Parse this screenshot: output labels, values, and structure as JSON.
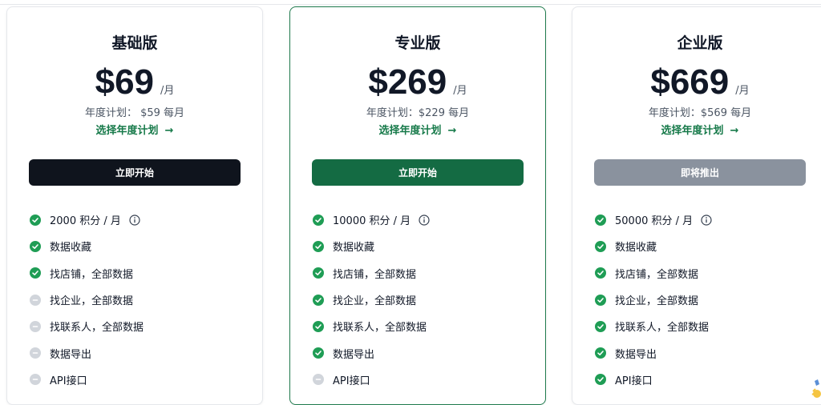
{
  "plans": [
    {
      "title": "基础版",
      "price": "$69",
      "period": "/月",
      "annual_text": "年度计划：  $59 每月",
      "annual_link": "选择年度计划",
      "cta": "立即开始",
      "cta_style": "dark",
      "features": [
        {
          "label": "2000 积分 / 月",
          "included": true,
          "info": true
        },
        {
          "label": "数据收藏",
          "included": true
        },
        {
          "label": "找店铺，全部数据",
          "included": true
        },
        {
          "label": "找企业，全部数据",
          "included": false
        },
        {
          "label": "找联系人，全部数据",
          "included": false
        },
        {
          "label": "数据导出",
          "included": false
        },
        {
          "label": "API接口",
          "included": false
        }
      ]
    },
    {
      "title": "专业版",
      "price": "$269",
      "period": "/月",
      "annual_text": "年度计划：$229 每月",
      "annual_link": "选择年度计划",
      "cta": "立即开始",
      "cta_style": "green",
      "featured": true,
      "features": [
        {
          "label": "10000 积分 / 月",
          "included": true,
          "info": true
        },
        {
          "label": "数据收藏",
          "included": true
        },
        {
          "label": "找店铺，全部数据",
          "included": true
        },
        {
          "label": "找企业，全部数据",
          "included": true
        },
        {
          "label": "找联系人，全部数据",
          "included": true
        },
        {
          "label": "数据导出",
          "included": true
        },
        {
          "label": "API接口",
          "included": false
        }
      ]
    },
    {
      "title": "企业版",
      "price": "$669",
      "period": "/月",
      "annual_text": "年度计划：$569 每月",
      "annual_link": "选择年度计划",
      "cta": "即将推出",
      "cta_style": "gray",
      "features": [
        {
          "label": "50000 积分 / 月",
          "included": true,
          "info": true
        },
        {
          "label": "数据收藏",
          "included": true
        },
        {
          "label": "找店铺，全部数据",
          "included": true
        },
        {
          "label": "找企业，全部数据",
          "included": true
        },
        {
          "label": "找联系人，全部数据",
          "included": true
        },
        {
          "label": "数据导出",
          "included": true
        },
        {
          "label": "API接口",
          "included": true
        }
      ]
    }
  ],
  "colors": {
    "accent_green": "#177a4a",
    "check_green": "#1f9d55",
    "check_gray": "#d1d5db",
    "featured_border": "#1f7a4d"
  },
  "icons": {
    "check": "check-circle-icon",
    "excluded": "minus-circle-icon",
    "info": "info-icon",
    "arrow": "arrow-right-icon"
  }
}
